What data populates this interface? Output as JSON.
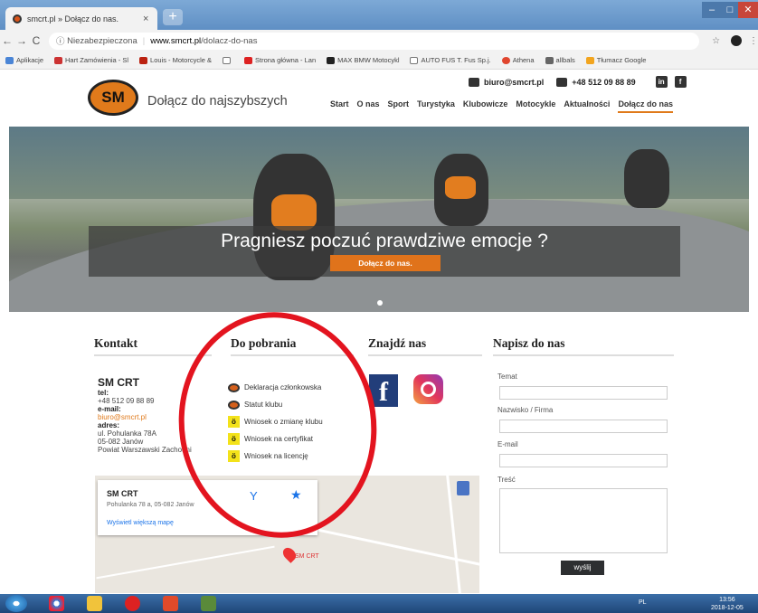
{
  "browser": {
    "tab_title": "smcrt.pl » Dołącz do nas.",
    "tab_close": "×",
    "new_tab": "+",
    "insecure_label": "Niezabezpieczona",
    "url_domain": "www.smcrt.pl",
    "url_path": "/dolacz-do-nas",
    "bookmarks": [
      "Aplikacje",
      "Hart Zamówienia - Sl",
      "Louis - Motorcycle &",
      "",
      "Strona główna - Lan",
      "MAX BMW Motocykl",
      "AUTO FUS T. Fus Sp.j.",
      "Athena",
      "allbals",
      "Tłumacz Google"
    ]
  },
  "site": {
    "logo_text": "SM",
    "tagline": "Dołącz do najszybszych",
    "email": "biuro@smcrt.pl",
    "phone": "+48 512 09 88 89",
    "menu": [
      "Start",
      "O nas",
      "Sport",
      "Turystyka",
      "Klubowicze",
      "Motocykle",
      "Aktualności",
      "Dołącz do nas"
    ]
  },
  "hero": {
    "headline": "Pragniesz poczuć prawdziwe emocje ?",
    "cta": "Dołącz do nas."
  },
  "kontakt": {
    "heading": "Kontakt",
    "name": "SM CRT",
    "tel_label": "tel:",
    "tel": "+48 512 09 88 89",
    "email_label": "e-mail:",
    "email": "biuro@smcrt.pl",
    "adres_label": "adres:",
    "street": "ul. Pohulanka 78A",
    "city": "05-082 Janów",
    "county": "Powiat Warszawski Zachodni"
  },
  "downloads": {
    "heading": "Do pobrania",
    "items": [
      "Deklaracja członkowska",
      "Statut klubu",
      "Wniosek o zmianę klubu",
      "Wniosek na certyfikat",
      "Wniosek na licencję"
    ]
  },
  "social": {
    "heading": "Znajdź nas"
  },
  "form": {
    "heading": "Napisz do nas",
    "temat": "Temat",
    "nazwisko": "Nazwisko / Firma",
    "email": "E-mail",
    "tresc": "Treść",
    "send": "wyślij"
  },
  "map": {
    "name": "SM CRT",
    "address": "Pohulanka 78 a, 05-082 Janów",
    "bigger_map": "Wyświetl większą mapę",
    "pin_label": "SM CRT"
  },
  "taskbar": {
    "lang": "PL",
    "time": "13:56",
    "date": "2018-12-05"
  }
}
